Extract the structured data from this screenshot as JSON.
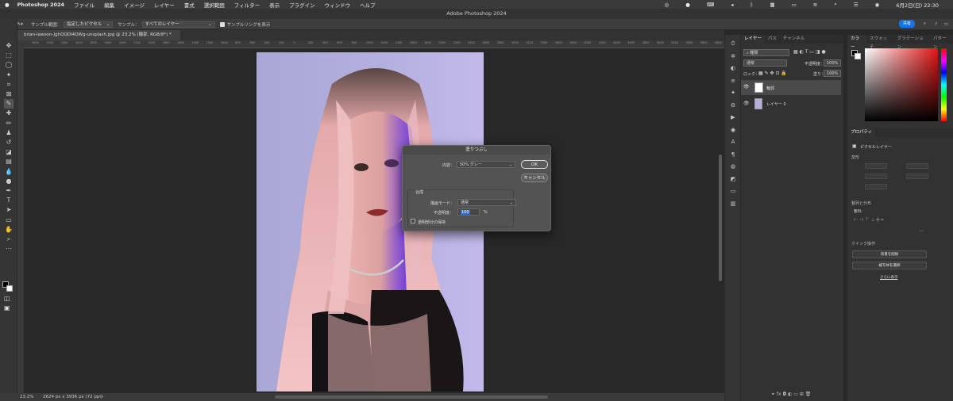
{
  "menubar": {
    "app": "Photoshop 2024",
    "items": [
      "ファイル",
      "編集",
      "イメージ",
      "レイヤー",
      "書式",
      "選択範囲",
      "フィルター",
      "表示",
      "プラグイン",
      "ウィンドウ",
      "ヘルプ"
    ],
    "datetime": "6月2日(日)  22:30"
  },
  "window_title": "Adobe Photoshop 2024",
  "options": {
    "sample_range_label": "サンプル範囲：",
    "sample_range_value": "指定したピクセル",
    "sample_label": "サンプル：",
    "sample_value": "すべてのレイヤー",
    "show_ring_label": "サンプルリングを表示",
    "share": "共有"
  },
  "document_tab": "brian-lawson-JghQQDI4QWg-unsplash.jpg @ 23.2% (輪郭, RGB/8*) *",
  "ruler_ticks": [
    "3600",
    "3400",
    "3200",
    "3000",
    "2800",
    "2600",
    "2400",
    "2200",
    "2000",
    "1800",
    "1600",
    "1400",
    "1200",
    "1000",
    "800",
    "600",
    "400",
    "200",
    "0",
    "200",
    "400",
    "600",
    "800",
    "1000",
    "1200",
    "1400",
    "1600",
    "1800",
    "2000",
    "2200",
    "2400",
    "2600",
    "2800",
    "3000",
    "3200",
    "3400",
    "3600",
    "3800",
    "4000",
    "4200",
    "4400",
    "4600",
    "4800",
    "5000",
    "5200",
    "5400",
    "5600",
    "5800",
    "6000"
  ],
  "status": {
    "zoom": "23.2%",
    "doc_info": "2624 px x 3936 px (72 ppi)"
  },
  "dialog": {
    "title": "塗りつぶし",
    "content_label": "内容：",
    "content_value": "50% グレー",
    "ok": "OK",
    "cancel": "キャンセル",
    "blend_section": "合成",
    "mode_label": "描画モード：",
    "mode_value": "通常",
    "opacity_label": "不透明度：",
    "opacity_value": "100",
    "opacity_unit": "%",
    "preserve_label": "透明部分の保持"
  },
  "layers_panel": {
    "tabs": [
      "レイヤー",
      "パス",
      "チャンネル"
    ],
    "kind": "種類",
    "blend": "通常",
    "opacity_label": "不透明度：",
    "opacity_value": "100%",
    "lock_label": "ロック：",
    "fill_label": "塗り：",
    "fill_value": "100%",
    "layers": [
      {
        "name": "輪郭"
      },
      {
        "name": "レイヤー 0"
      }
    ]
  },
  "color_panel": {
    "tabs": [
      "カラー",
      "スウォッチ",
      "グラデーション",
      "パターン"
    ]
  },
  "properties_panel": {
    "title": "プロパティ",
    "type": "ピクセルレイヤー",
    "transform": "変形",
    "align": "整列と分布",
    "align_label": "整列：",
    "quick": "クイック操作",
    "remove_bg": "背景を削除",
    "select_subject": "被写体を選択",
    "more": "さらに表示"
  }
}
